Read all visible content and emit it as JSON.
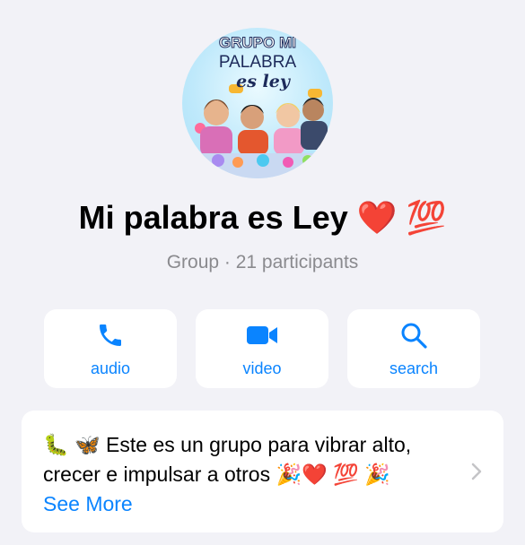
{
  "group": {
    "avatar_text": [
      "GRUPO MI",
      "PALABRA",
      "es ley"
    ],
    "title": "Mi palabra es Ley ❤️ 💯",
    "subtitle": "Group · 21 participants"
  },
  "actions": [
    {
      "label": "audio",
      "icon": "phone-icon"
    },
    {
      "label": "video",
      "icon": "video-camera-icon"
    },
    {
      "label": "search",
      "icon": "search-icon"
    }
  ],
  "description": {
    "text": "🐛 🦋 Este es un grupo para vibrar alto, crecer e impulsar a otros 🎉❤️ 💯 🎉",
    "see_more": "See More"
  },
  "colors": {
    "accent": "#0a84ff",
    "background": "#f2f2f7",
    "card": "#ffffff",
    "secondary_text": "#8a8a8e"
  }
}
